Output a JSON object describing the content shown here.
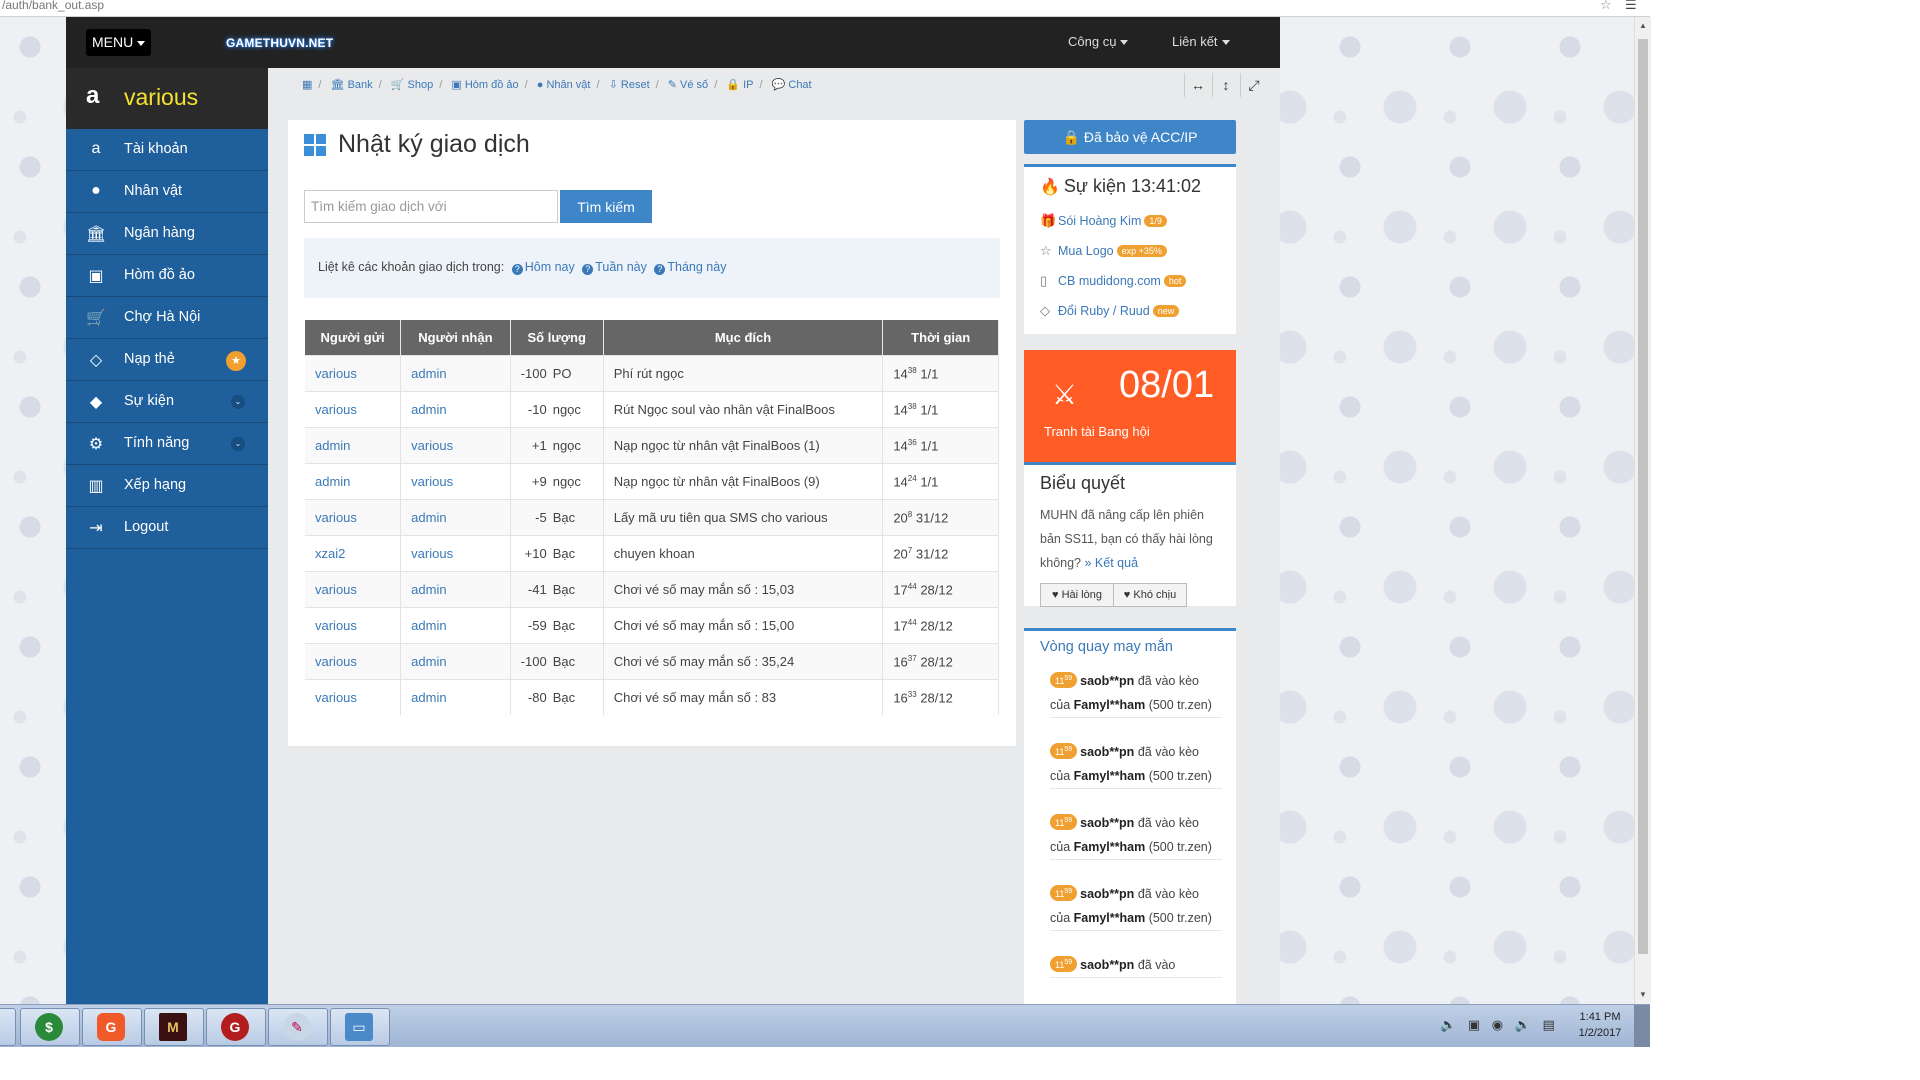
{
  "browser": {
    "url": "/auth/bank_out.asp"
  },
  "topbar": {
    "menu_label": "MENU",
    "logo_text": "GAMETHUVN.NET",
    "links": [
      "Công cụ",
      "Liên kết"
    ]
  },
  "sidebar": {
    "username": "various",
    "items": [
      {
        "label": "Tài khoản",
        "icon": "amazon-icon"
      },
      {
        "label": "Nhân vật",
        "icon": "user-icon"
      },
      {
        "label": "Ngân hàng",
        "icon": "bank-icon"
      },
      {
        "label": "Hòm đồ ảo",
        "icon": "briefcase-icon"
      },
      {
        "label": "Chợ Hà Nội",
        "icon": "cart-icon"
      },
      {
        "label": "Nạp thẻ",
        "icon": "diamond-icon"
      },
      {
        "label": "Sự kiện",
        "icon": "android-icon"
      },
      {
        "label": "Tính năng",
        "icon": "gears-icon"
      },
      {
        "label": "Xếp hạng",
        "icon": "bar-chart-icon"
      },
      {
        "label": "Logout",
        "icon": "sign-out-icon"
      }
    ]
  },
  "breadcrumb": [
    "Bank",
    "Shop",
    "Hòm đồ ảo",
    "Nhân vật",
    "Reset",
    "Vé số",
    "IP",
    "Chat"
  ],
  "main": {
    "title": "Nhật ký giao dịch",
    "search_placeholder": "Tìm kiếm giao dịch với",
    "search_button": "Tìm kiếm",
    "filter_text": "Liệt kê các khoản giao dịch trong:",
    "filter_links": [
      "Hôm nay",
      "Tuần này",
      "Tháng này"
    ],
    "columns": [
      "Người gửi",
      "Người nhận",
      "Số lượng",
      "Mục đích",
      "Thời gian"
    ],
    "rows": [
      {
        "from": "various",
        "to": "admin",
        "amount": "-100",
        "unit": "PO",
        "purpose": "Phí rút ngọc",
        "h": "14",
        "m": "38",
        "date": "1/1"
      },
      {
        "from": "various",
        "to": "admin",
        "amount": "-10",
        "unit": "ngọc",
        "purpose": "Rút Ngọc soul vào nhân vật FinalBoos",
        "h": "14",
        "m": "38",
        "date": "1/1"
      },
      {
        "from": "admin",
        "to": "various",
        "amount": "+1",
        "unit": "ngọc",
        "purpose": "Nạp ngọc từ nhân vật FinalBoos (1)",
        "h": "14",
        "m": "36",
        "date": "1/1"
      },
      {
        "from": "admin",
        "to": "various",
        "amount": "+9",
        "unit": "ngọc",
        "purpose": "Nạp ngọc từ nhân vật FinalBoos (9)",
        "h": "14",
        "m": "24",
        "date": "1/1"
      },
      {
        "from": "various",
        "to": "admin",
        "amount": "-5",
        "unit": "Bạc",
        "purpose": "Lấy mã ưu tiên qua SMS cho various",
        "h": "20",
        "m": "8",
        "date": "31/12"
      },
      {
        "from": "xzai2",
        "to": "various",
        "amount": "+10",
        "unit": "Bạc",
        "purpose": "chuyen khoan",
        "h": "20",
        "m": "7",
        "date": "31/12"
      },
      {
        "from": "various",
        "to": "admin",
        "amount": "-41",
        "unit": "Bạc",
        "purpose": "Chơi vé số may mắn số : 15,03",
        "h": "17",
        "m": "44",
        "date": "28/12"
      },
      {
        "from": "various",
        "to": "admin",
        "amount": "-59",
        "unit": "Bạc",
        "purpose": "Chơi vé số may mắn số : 15,00",
        "h": "17",
        "m": "44",
        "date": "28/12"
      },
      {
        "from": "various",
        "to": "admin",
        "amount": "-100",
        "unit": "Bạc",
        "purpose": "Chơi vé số may mắn số : 35,24",
        "h": "16",
        "m": "37",
        "date": "28/12"
      },
      {
        "from": "various",
        "to": "admin",
        "amount": "-80",
        "unit": "Bạc",
        "purpose": "Chơi vé số may mắn số : 83",
        "h": "16",
        "m": "33",
        "date": "28/12"
      }
    ]
  },
  "right": {
    "protect_label": "Đã bảo vệ ACC/IP",
    "event_title": "Sự kiện 13:41:02",
    "events": [
      {
        "label": "Sói Hoàng Kim",
        "badge": "1/9",
        "icon": "gift-icon"
      },
      {
        "label": "Mua Logo",
        "badge": "exp +35%",
        "icon": "star-icon"
      },
      {
        "label": "CB mudidong.com",
        "badge": "hot",
        "icon": "mobile-icon"
      },
      {
        "label": "Đổi Ruby / Ruud",
        "badge": "new",
        "icon": "diamond-icon"
      }
    ],
    "war_date": "08/01",
    "war_label": "Tranh tài Bang hội",
    "poll_title": "Biểu quyết",
    "poll_question": "MUHN đã nâng cấp lên phiên bản SS11, bạn có thấy hài lòng không?",
    "poll_result_link": "» Kết quả",
    "poll_yes": "Hài lòng",
    "poll_no": "Khó chịu",
    "lucky_title": "Vòng quay may mắn",
    "lucky_items": [
      {
        "time_h": "11",
        "time_m": "59",
        "user": "saob**pn",
        "mid": "đã vào kèo của",
        "target": "Famyl**ham",
        "amount": "(500 tr.zen)"
      },
      {
        "time_h": "11",
        "time_m": "59",
        "user": "saob**pn",
        "mid": "đã vào kèo của",
        "target": "Famyl**ham",
        "amount": "(500 tr.zen)"
      },
      {
        "time_h": "11",
        "time_m": "59",
        "user": "saob**pn",
        "mid": "đã vào kèo của",
        "target": "Famyl**ham",
        "amount": "(500 tr.zen)"
      },
      {
        "time_h": "11",
        "time_m": "59",
        "user": "saob**pn",
        "mid": "đã vào kèo của",
        "target": "Famyl**ham",
        "amount": "(500 tr.zen)"
      },
      {
        "time_h": "11",
        "time_m": "59",
        "user": "saob**pn",
        "mid": "đã vào",
        "target": "",
        "amount": ""
      }
    ]
  },
  "taskbar": {
    "time": "1:41 PM",
    "date": "1/2/2017"
  }
}
